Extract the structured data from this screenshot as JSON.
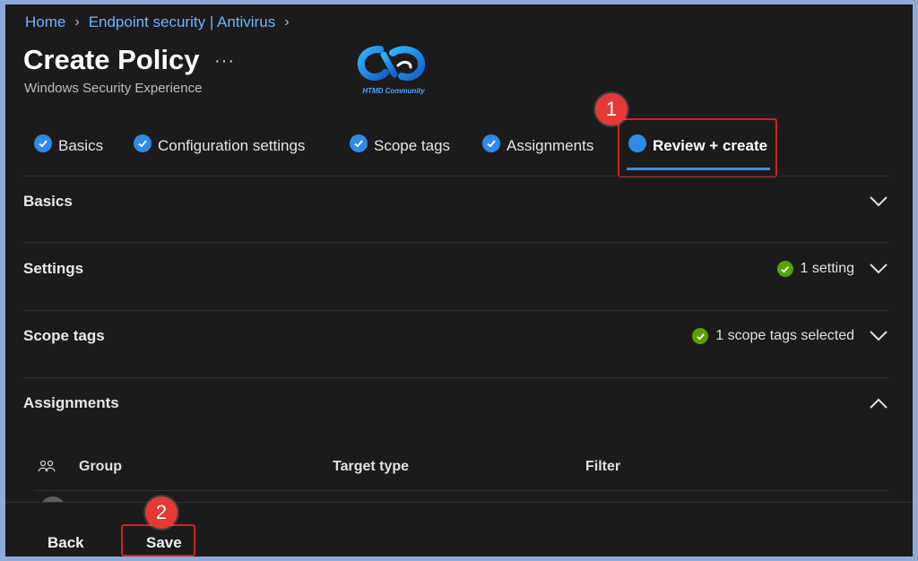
{
  "breadcrumb": {
    "items": [
      "Home",
      "Endpoint security | Antivirus"
    ]
  },
  "header": {
    "title": "Create Policy",
    "more": "···",
    "subtitle": "Windows Security Experience",
    "logo_text": "HTMD Community"
  },
  "tabs": [
    {
      "label": "Basics",
      "state": "complete"
    },
    {
      "label": "Configuration settings",
      "state": "complete"
    },
    {
      "label": "Scope tags",
      "state": "complete"
    },
    {
      "label": "Assignments",
      "state": "complete"
    },
    {
      "label": "Review + create",
      "state": "active"
    }
  ],
  "sections": [
    {
      "label": "Basics",
      "status": "",
      "expanded": false
    },
    {
      "label": "Settings",
      "status": "1 setting",
      "expanded": false
    },
    {
      "label": "Scope tags",
      "status": "1 scope tags selected",
      "expanded": false
    },
    {
      "label": "Assignments",
      "status": "",
      "expanded": true
    }
  ],
  "assignments_table": {
    "columns": [
      "Group",
      "Target type",
      "Filter"
    ]
  },
  "footer": {
    "back": "Back",
    "save": "Save"
  },
  "annotations": {
    "badge1": "1",
    "badge2": "2"
  },
  "colors": {
    "accent": "#2f8ae6",
    "highlight": "#d21f26",
    "success": "#57a300",
    "background": "#1b1b1b"
  }
}
